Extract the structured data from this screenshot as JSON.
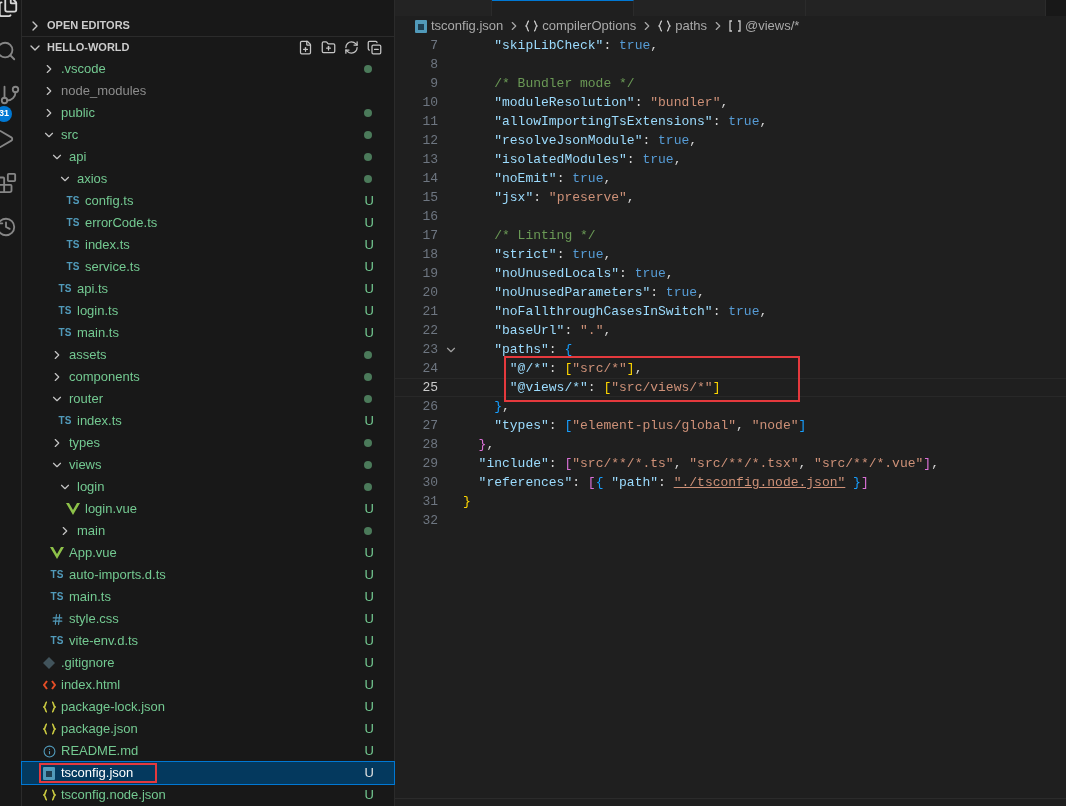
{
  "activity_bar": {
    "badge": "31"
  },
  "tabs": [
    {
      "selected": false
    },
    {
      "selected": true
    },
    {
      "selected": false
    },
    {
      "selected": false
    }
  ],
  "sidebar": {
    "sections": [
      {
        "title": "OPEN EDITORS",
        "expanded": false
      },
      {
        "title": "HELLO-WORLD",
        "expanded": true
      }
    ],
    "tree": [
      {
        "name": ".vscode",
        "kind": "folder",
        "expanded": false,
        "dot": true,
        "ignored": false,
        "selected": false,
        "boxed": false
      },
      {
        "name": "node_modules",
        "kind": "folder",
        "expanded": false,
        "dot": false,
        "ignored": true,
        "selected": false,
        "boxed": false
      },
      {
        "name": "public",
        "kind": "folder",
        "expanded": false,
        "dot": true,
        "ignored": false,
        "selected": false,
        "boxed": false
      },
      {
        "name": "src",
        "kind": "folder",
        "expanded": true,
        "dot": true,
        "ignored": false,
        "selected": false,
        "boxed": false,
        "children": [
          {
            "name": "api",
            "kind": "folder",
            "expanded": true,
            "dot": true,
            "ignored": false,
            "selected": false,
            "boxed": false,
            "children": [
              {
                "name": "axios",
                "kind": "folder",
                "expanded": true,
                "dot": true,
                "ignored": false,
                "selected": false,
                "boxed": false,
                "children": [
                  {
                    "name": "config.ts",
                    "kind": "ts",
                    "icon_label": "TS",
                    "status": "U",
                    "ignored": false,
                    "selected": false,
                    "boxed": false
                  },
                  {
                    "name": "errorCode.ts",
                    "kind": "ts",
                    "icon_label": "TS",
                    "status": "U",
                    "ignored": false,
                    "selected": false,
                    "boxed": false
                  },
                  {
                    "name": "index.ts",
                    "kind": "ts",
                    "icon_label": "TS",
                    "status": "U",
                    "ignored": false,
                    "selected": false,
                    "boxed": false
                  },
                  {
                    "name": "service.ts",
                    "kind": "ts",
                    "icon_label": "TS",
                    "status": "U",
                    "ignored": false,
                    "selected": false,
                    "boxed": false
                  }
                ]
              },
              {
                "name": "api.ts",
                "kind": "ts",
                "icon_label": "TS",
                "status": "U",
                "ignored": false,
                "selected": false,
                "boxed": false
              },
              {
                "name": "login.ts",
                "kind": "ts",
                "icon_label": "TS",
                "status": "U",
                "ignored": false,
                "selected": false,
                "boxed": false
              },
              {
                "name": "main.ts",
                "kind": "ts",
                "icon_label": "TS",
                "status": "U",
                "ignored": false,
                "selected": false,
                "boxed": false
              }
            ]
          },
          {
            "name": "assets",
            "kind": "folder",
            "expanded": false,
            "dot": true,
            "ignored": false,
            "selected": false,
            "boxed": false
          },
          {
            "name": "components",
            "kind": "folder",
            "expanded": false,
            "dot": true,
            "ignored": false,
            "selected": false,
            "boxed": false
          },
          {
            "name": "router",
            "kind": "folder",
            "expanded": true,
            "dot": true,
            "ignored": false,
            "selected": false,
            "boxed": false,
            "children": [
              {
                "name": "index.ts",
                "kind": "ts",
                "icon_label": "TS",
                "status": "U",
                "ignored": false,
                "selected": false,
                "boxed": false
              }
            ]
          },
          {
            "name": "types",
            "kind": "folder",
            "expanded": false,
            "dot": true,
            "ignored": false,
            "selected": false,
            "boxed": false
          },
          {
            "name": "views",
            "kind": "folder",
            "expanded": true,
            "dot": true,
            "ignored": false,
            "selected": false,
            "boxed": false,
            "children": [
              {
                "name": "login",
                "kind": "folder",
                "expanded": true,
                "dot": true,
                "ignored": false,
                "selected": false,
                "boxed": false,
                "children": [
                  {
                    "name": "login.vue",
                    "kind": "vue",
                    "status": "U",
                    "ignored": false,
                    "selected": false,
                    "boxed": false
                  }
                ]
              },
              {
                "name": "main",
                "kind": "folder",
                "expanded": false,
                "dot": true,
                "ignored": false,
                "selected": false,
                "boxed": false
              }
            ]
          },
          {
            "name": "App.vue",
            "kind": "vue",
            "status": "U",
            "ignored": false,
            "selected": false,
            "boxed": false
          },
          {
            "name": "auto-imports.d.ts",
            "kind": "ts",
            "icon_label": "TS",
            "status": "U",
            "ignored": false,
            "selected": false,
            "boxed": false
          },
          {
            "name": "main.ts",
            "kind": "ts",
            "icon_label": "TS",
            "status": "U",
            "ignored": false,
            "selected": false,
            "boxed": false
          },
          {
            "name": "style.css",
            "kind": "css",
            "status": "U",
            "ignored": false,
            "selected": false,
            "boxed": false
          },
          {
            "name": "vite-env.d.ts",
            "kind": "ts",
            "icon_label": "TS",
            "status": "U",
            "ignored": false,
            "selected": false,
            "boxed": false
          }
        ]
      },
      {
        "name": ".gitignore",
        "kind": "git",
        "status": "U",
        "ignored": false,
        "selected": false,
        "boxed": false
      },
      {
        "name": "index.html",
        "kind": "html",
        "status": "U",
        "ignored": false,
        "selected": false,
        "boxed": false
      },
      {
        "name": "package-lock.json",
        "kind": "json",
        "status": "U",
        "ignored": false,
        "selected": false,
        "boxed": false
      },
      {
        "name": "package.json",
        "kind": "json",
        "status": "U",
        "ignored": false,
        "selected": false,
        "boxed": false
      },
      {
        "name": "README.md",
        "kind": "info",
        "status": "U",
        "ignored": false,
        "selected": false,
        "boxed": false
      },
      {
        "name": "tsconfig.json",
        "kind": "tsconfig",
        "status": "U",
        "ignored": false,
        "selected": true,
        "boxed": true
      },
      {
        "name": "tsconfig.node.json",
        "kind": "json",
        "status": "U",
        "ignored": false,
        "selected": false,
        "boxed": false
      }
    ]
  },
  "breadcrumb": [
    {
      "kind": "file",
      "text": "tsconfig.json"
    },
    {
      "kind": "object",
      "text": "compilerOptions"
    },
    {
      "kind": "object",
      "text": "paths"
    },
    {
      "kind": "array",
      "text": "@views/*"
    }
  ],
  "editor": {
    "lines": [
      {
        "number": "7",
        "current": false,
        "boxed": false,
        "tokens": [
          {
            "kind": "key",
            "text": "    \"skipLibCheck\""
          },
          {
            "kind": "punct",
            "text": ": "
          },
          {
            "kind": "bool",
            "text": "true"
          },
          {
            "kind": "punct",
            "text": ","
          }
        ]
      },
      {
        "number": "8",
        "current": false,
        "boxed": false
      },
      {
        "number": "9",
        "current": false,
        "boxed": false,
        "tokens": [
          {
            "kind": "comment",
            "text": "    /* Bundler mode */"
          }
        ]
      },
      {
        "number": "10",
        "current": false,
        "boxed": false,
        "tokens": [
          {
            "kind": "key",
            "text": "    \"moduleResolution\""
          },
          {
            "kind": "punct",
            "text": ": "
          },
          {
            "kind": "string",
            "text": "\"bundler\""
          },
          {
            "kind": "punct",
            "text": ","
          }
        ]
      },
      {
        "number": "11",
        "current": false,
        "boxed": false,
        "tokens": [
          {
            "kind": "key",
            "text": "    \"allowImportingTsExtensions\""
          },
          {
            "kind": "punct",
            "text": ": "
          },
          {
            "kind": "bool",
            "text": "true"
          },
          {
            "kind": "punct",
            "text": ","
          }
        ]
      },
      {
        "number": "12",
        "current": false,
        "boxed": false,
        "tokens": [
          {
            "kind": "key",
            "text": "    \"resolveJsonModule\""
          },
          {
            "kind": "punct",
            "text": ": "
          },
          {
            "kind": "bool",
            "text": "true"
          },
          {
            "kind": "punct",
            "text": ","
          }
        ]
      },
      {
        "number": "13",
        "current": false,
        "boxed": false,
        "tokens": [
          {
            "kind": "key",
            "text": "    \"isolatedModules\""
          },
          {
            "kind": "punct",
            "text": ": "
          },
          {
            "kind": "bool",
            "text": "true"
          },
          {
            "kind": "punct",
            "text": ","
          }
        ]
      },
      {
        "number": "14",
        "current": false,
        "boxed": false,
        "tokens": [
          {
            "kind": "key",
            "text": "    \"noEmit\""
          },
          {
            "kind": "punct",
            "text": ": "
          },
          {
            "kind": "bool",
            "text": "true"
          },
          {
            "kind": "punct",
            "text": ","
          }
        ]
      },
      {
        "number": "15",
        "current": false,
        "boxed": false,
        "tokens": [
          {
            "kind": "key",
            "text": "    \"jsx\""
          },
          {
            "kind": "punct",
            "text": ": "
          },
          {
            "kind": "string",
            "text": "\"preserve\""
          },
          {
            "kind": "punct",
            "text": ","
          }
        ]
      },
      {
        "number": "16",
        "current": false,
        "boxed": false
      },
      {
        "number": "17",
        "current": false,
        "boxed": false,
        "tokens": [
          {
            "kind": "comment",
            "text": "    /* Linting */"
          }
        ]
      },
      {
        "number": "18",
        "current": false,
        "boxed": false,
        "tokens": [
          {
            "kind": "key",
            "text": "    \"strict\""
          },
          {
            "kind": "punct",
            "text": ": "
          },
          {
            "kind": "bool",
            "text": "true"
          },
          {
            "kind": "punct",
            "text": ","
          }
        ]
      },
      {
        "number": "19",
        "current": false,
        "boxed": false,
        "tokens": [
          {
            "kind": "key",
            "text": "    \"noUnusedLocals\""
          },
          {
            "kind": "punct",
            "text": ": "
          },
          {
            "kind": "bool",
            "text": "true"
          },
          {
            "kind": "punct",
            "text": ","
          }
        ]
      },
      {
        "number": "20",
        "current": false,
        "boxed": false,
        "tokens": [
          {
            "kind": "key",
            "text": "    \"noUnusedParameters\""
          },
          {
            "kind": "punct",
            "text": ": "
          },
          {
            "kind": "bool",
            "text": "true"
          },
          {
            "kind": "punct",
            "text": ","
          }
        ]
      },
      {
        "number": "21",
        "current": false,
        "boxed": false,
        "tokens": [
          {
            "kind": "key",
            "text": "    \"noFallthroughCasesInSwitch\""
          },
          {
            "kind": "punct",
            "text": ": "
          },
          {
            "kind": "bool",
            "text": "true"
          },
          {
            "kind": "punct",
            "text": ","
          }
        ]
      },
      {
        "number": "22",
        "current": false,
        "boxed": false,
        "tokens": [
          {
            "kind": "key",
            "text": "    \"baseUrl\""
          },
          {
            "kind": "punct",
            "text": ": "
          },
          {
            "kind": "string",
            "text": "\".\""
          },
          {
            "kind": "punct",
            "text": ","
          }
        ]
      },
      {
        "number": "23",
        "current": false,
        "boxed": false,
        "foldable": true,
        "tokens": [
          {
            "kind": "key",
            "text": "    \"paths\""
          },
          {
            "kind": "punct",
            "text": ": "
          },
          {
            "kind": "bracket3",
            "text": "{"
          }
        ]
      },
      {
        "number": "24",
        "current": false,
        "boxed": true,
        "tokens": [
          {
            "kind": "key",
            "text": "      \"@/*\""
          },
          {
            "kind": "punct",
            "text": ": "
          },
          {
            "kind": "bracket1",
            "text": "["
          },
          {
            "kind": "string",
            "text": "\"src/*\""
          },
          {
            "kind": "bracket1",
            "text": "]"
          },
          {
            "kind": "punct",
            "text": ","
          }
        ]
      },
      {
        "number": "25",
        "current": true,
        "boxed": true,
        "tokens": [
          {
            "kind": "key",
            "text": "      \"@views/*\""
          },
          {
            "kind": "punct",
            "text": ": "
          },
          {
            "kind": "bracket1",
            "text": "["
          },
          {
            "kind": "string",
            "text": "\"src/views/*\""
          },
          {
            "kind": "bracket1",
            "text": "]"
          }
        ]
      },
      {
        "number": "26",
        "current": false,
        "boxed": false,
        "tokens": [
          {
            "kind": "bracket3",
            "text": "    }"
          },
          {
            "kind": "punct",
            "text": ","
          }
        ]
      },
      {
        "number": "27",
        "current": false,
        "boxed": false,
        "tokens": [
          {
            "kind": "key",
            "text": "    \"types\""
          },
          {
            "kind": "punct",
            "text": ": "
          },
          {
            "kind": "bracket3",
            "text": "["
          },
          {
            "kind": "string",
            "text": "\"element-plus/global\""
          },
          {
            "kind": "punct",
            "text": ", "
          },
          {
            "kind": "string",
            "text": "\"node\""
          },
          {
            "kind": "bracket3",
            "text": "]"
          }
        ]
      },
      {
        "number": "28",
        "current": false,
        "boxed": false,
        "tokens": [
          {
            "kind": "bracket2",
            "text": "  }"
          },
          {
            "kind": "punct",
            "text": ","
          }
        ]
      },
      {
        "number": "29",
        "current": false,
        "boxed": false,
        "tokens": [
          {
            "kind": "key",
            "text": "  \"include\""
          },
          {
            "kind": "punct",
            "text": ": "
          },
          {
            "kind": "bracket2",
            "text": "["
          },
          {
            "kind": "string",
            "text": "\"src/**/*.ts\""
          },
          {
            "kind": "punct",
            "text": ", "
          },
          {
            "kind": "string",
            "text": "\"src/**/*.tsx\""
          },
          {
            "kind": "punct",
            "text": ", "
          },
          {
            "kind": "string",
            "text": "\"src/**/*.vue\""
          },
          {
            "kind": "bracket2",
            "text": "]"
          },
          {
            "kind": "punct",
            "text": ","
          }
        ]
      },
      {
        "number": "30",
        "current": false,
        "boxed": false,
        "tokens": [
          {
            "kind": "key",
            "text": "  \"references\""
          },
          {
            "kind": "punct",
            "text": ": "
          },
          {
            "kind": "bracket2",
            "text": "["
          },
          {
            "kind": "bracket3",
            "text": "{"
          },
          {
            "kind": "key",
            "text": " \"path\""
          },
          {
            "kind": "punct",
            "text": ": "
          },
          {
            "kind": "link",
            "text": "\"./tsconfig.node.json\""
          },
          {
            "kind": "bracket3",
            "text": " }"
          },
          {
            "kind": "bracket2",
            "text": "]"
          }
        ]
      },
      {
        "number": "31",
        "current": false,
        "boxed": false,
        "tokens": [
          {
            "kind": "bracket1",
            "text": "}"
          }
        ]
      },
      {
        "number": "32",
        "current": false,
        "boxed": false
      }
    ]
  }
}
